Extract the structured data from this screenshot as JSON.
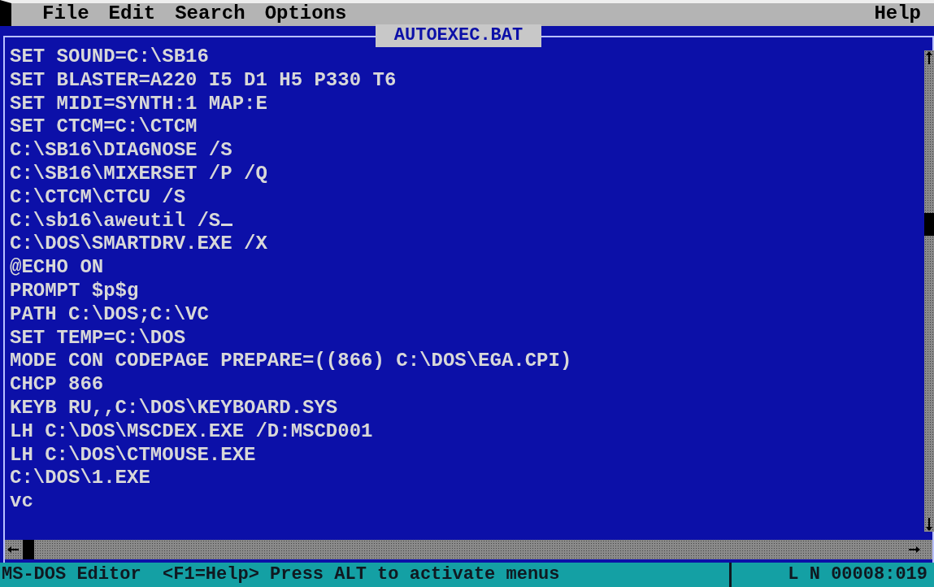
{
  "menu_bar": {
    "menus": [
      "File",
      "Edit",
      "Search",
      "Options"
    ],
    "right_menus": [
      "Help"
    ]
  },
  "editor": {
    "title": "AUTOEXEC.BAT",
    "lines": [
      {
        "text": "SET SOUND=C:\\SB16",
        "cursor": false
      },
      {
        "text": "SET BLASTER=A220 I5 D1 H5 P330 T6",
        "cursor": false
      },
      {
        "text": "SET MIDI=SYNTH:1 MAP:E",
        "cursor": false
      },
      {
        "text": "SET CTCM=C:\\CTCM",
        "cursor": false
      },
      {
        "text": "C:\\SB16\\DIAGNOSE /S",
        "cursor": false
      },
      {
        "text": "C:\\SB16\\MIXERSET /P /Q",
        "cursor": false
      },
      {
        "text": "C:\\CTCM\\CTCU /S",
        "cursor": false
      },
      {
        "text": "C:\\sb16\\aweutil /S",
        "cursor": true
      },
      {
        "text": "C:\\DOS\\SMARTDRV.EXE /X",
        "cursor": false
      },
      {
        "text": "@ECHO ON",
        "cursor": false
      },
      {
        "text": "PROMPT $p$g",
        "cursor": false
      },
      {
        "text": "PATH C:\\DOS;C:\\VC",
        "cursor": false
      },
      {
        "text": "SET TEMP=C:\\DOS",
        "cursor": false
      },
      {
        "text": "MODE CON CODEPAGE PREPARE=((866) C:\\DOS\\EGA.CPI)",
        "cursor": false
      },
      {
        "text": "CHCP 866",
        "cursor": false
      },
      {
        "text": "KEYB RU,,C:\\DOS\\KEYBOARD.SYS",
        "cursor": false
      },
      {
        "text": "LH C:\\DOS\\MSCDEX.EXE /D:MSCD001",
        "cursor": false
      },
      {
        "text": "LH C:\\DOS\\CTMOUSE.EXE",
        "cursor": false
      },
      {
        "text": "C:\\DOS\\1.EXE",
        "cursor": false
      },
      {
        "text": "vc",
        "cursor": false
      }
    ]
  },
  "status_bar": {
    "message": "MS-DOS Editor  <F1=Help> Press ALT to activate menus",
    "position": "L N 00008:019"
  }
}
